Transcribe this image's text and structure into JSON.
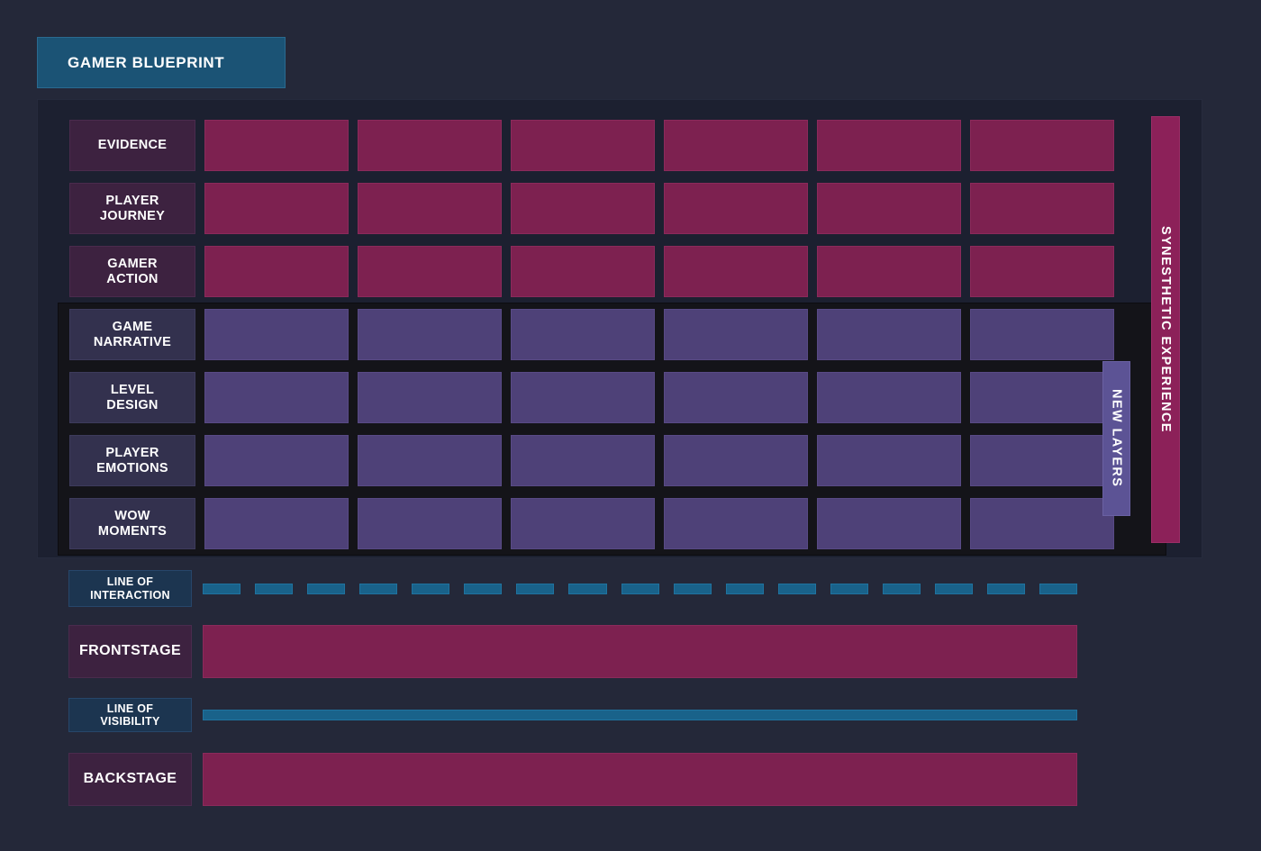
{
  "title": {
    "label": "GAMER BLUEPRINT"
  },
  "colors": {
    "page_background": "#242839",
    "panel_background": "#1C2030",
    "panel_dark": "#141419",
    "magenta_cell": "#7D2150",
    "magenta_label": "#3D2240",
    "purple_cell": "#4E4178",
    "purple_label": "#33314E",
    "teal_line": "#19628A",
    "teal_label": "#1C3550",
    "title_chip": "#1B5375",
    "synesthetic_tab": "#8C2159",
    "new_layers_tab": "#5C5395"
  },
  "chart_data": {
    "type": "table",
    "title": "GAMER BLUEPRINT",
    "columns": 6,
    "row_labels": [
      "EVIDENCE",
      "PLAYER JOURNEY",
      "GAMER ACTION",
      "GAME NARRATIVE",
      "LEVEL DESIGN",
      "PLAYER EMOTIONS",
      "WOW MOMENTS"
    ],
    "bands": [
      "magenta",
      "magenta",
      "magenta",
      "purple",
      "purple",
      "purple",
      "purple"
    ]
  },
  "grid": {
    "column_count": 6,
    "rows": [
      {
        "label_line1": "EVIDENCE",
        "label_line2": "",
        "band": "magenta"
      },
      {
        "label_line1": "PLAYER",
        "label_line2": "JOURNEY",
        "band": "magenta"
      },
      {
        "label_line1": "GAMER",
        "label_line2": "ACTION",
        "band": "magenta"
      },
      {
        "label_line1": "GAME",
        "label_line2": "NARRATIVE",
        "band": "purple"
      },
      {
        "label_line1": "LEVEL",
        "label_line2": "DESIGN",
        "band": "purple"
      },
      {
        "label_line1": "PLAYER",
        "label_line2": "EMOTIONS",
        "band": "purple"
      },
      {
        "label_line1": "WOW",
        "label_line2": "MOMENTS",
        "band": "purple"
      }
    ]
  },
  "side_tabs": {
    "synesthetic": "SYNESTHETIC EXPERIENCE",
    "new_layers": "NEW LAYERS"
  },
  "lanes": {
    "interaction": {
      "label_line1": "LINE OF",
      "label_line2": "INTERACTION",
      "style": "dashed",
      "dash_count": 17
    },
    "frontstage": {
      "label_line1": "FRONTSTAGE",
      "label_line2": "",
      "style": "solid-magenta"
    },
    "visibility": {
      "label_line1": "LINE OF",
      "label_line2": "VISIBILITY",
      "style": "solid-teal"
    },
    "backstage": {
      "label_line1": "BACKSTAGE",
      "label_line2": "",
      "style": "solid-magenta"
    }
  }
}
